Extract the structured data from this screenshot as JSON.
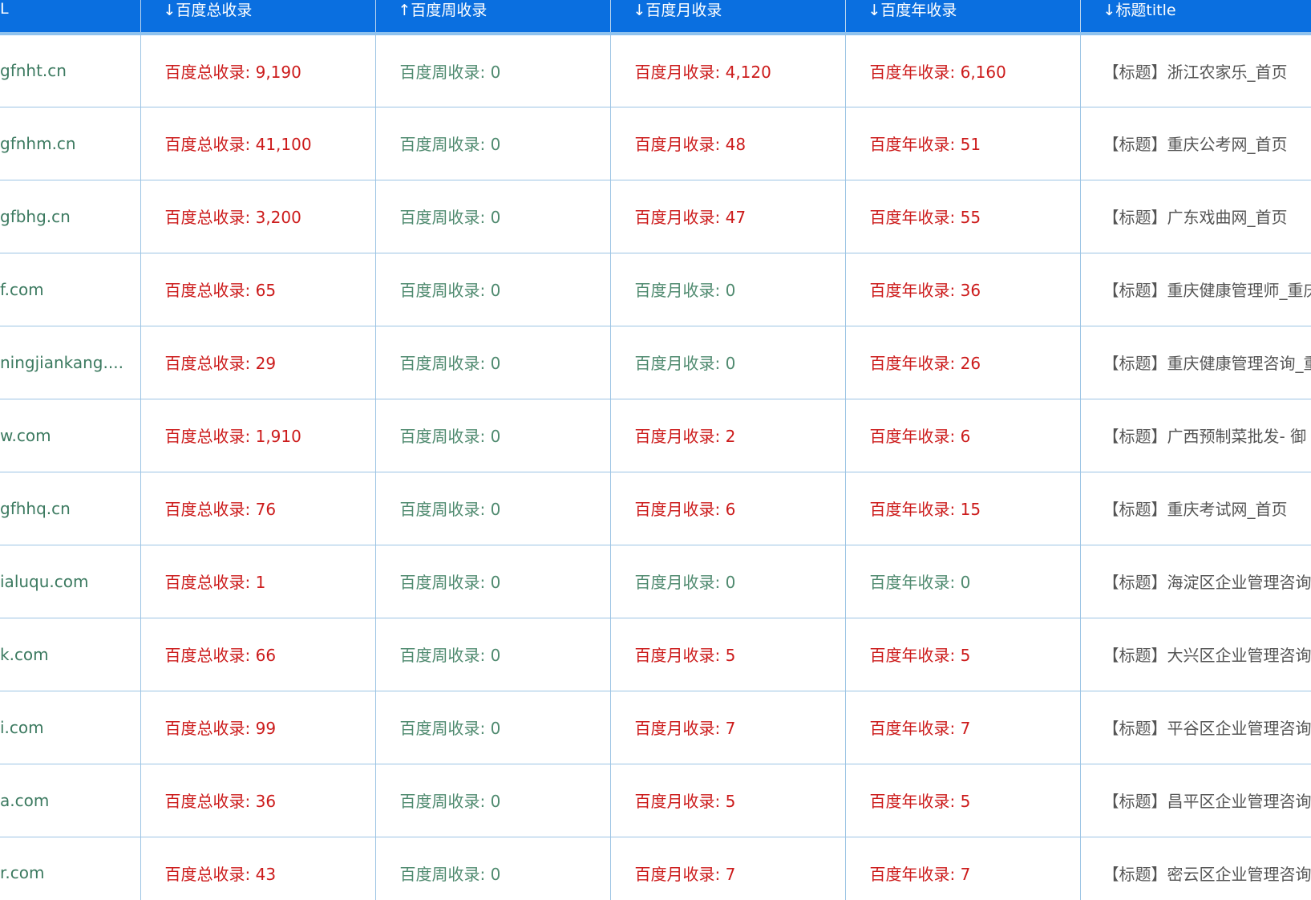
{
  "colors": {
    "header_bg": "#0a6fe0",
    "value_nonzero": "#cc1b1b",
    "value_zero": "#4f8a6f",
    "url_text": "#3c7a60"
  },
  "header": [
    "L",
    "↓百度总收录",
    "↑百度周收录",
    "↓百度月收录",
    "↓百度年收录",
    "↓标题title"
  ],
  "rows": [
    {
      "url": "gfnht.cn",
      "total": "百度总收录: 9,190",
      "week": "百度周收录: 0",
      "month": "百度月收录: 4,120",
      "year": "百度年收录: 6,160",
      "title": "【标题】浙江农家乐_首页"
    },
    {
      "url": "gfnhm.cn",
      "total": "百度总收录: 41,100",
      "week": "百度周收录: 0",
      "month": "百度月收录: 48",
      "year": "百度年收录: 51",
      "title": "【标题】重庆公考网_首页"
    },
    {
      "url": "gfbhg.cn",
      "total": "百度总收录: 3,200",
      "week": "百度周收录: 0",
      "month": "百度月收录: 47",
      "year": "百度年收录: 55",
      "title": "【标题】广东戏曲网_首页"
    },
    {
      "url": "f.com",
      "total": "百度总收录: 65",
      "week": "百度周收录: 0",
      "month": "百度月收录: 0",
      "year": "百度年收录: 36",
      "title": "【标题】重庆健康管理师_重庆"
    },
    {
      "url": "ningjiankang....",
      "total": "百度总收录: 29",
      "week": "百度周收录: 0",
      "month": "百度月收录: 0",
      "year": "百度年收录: 26",
      "title": "【标题】重庆健康管理咨询_重"
    },
    {
      "url": "w.com",
      "total": "百度总收录: 1,910",
      "week": "百度周收录: 0",
      "month": "百度月收录: 2",
      "year": "百度年收录: 6",
      "title": "【标题】广西预制菜批发- 御"
    },
    {
      "url": "gfhhq.cn",
      "total": "百度总收录: 76",
      "week": "百度周收录: 0",
      "month": "百度月收录: 6",
      "year": "百度年收录: 15",
      "title": "【标题】重庆考试网_首页"
    },
    {
      "url": "ialuqu.com",
      "total": "百度总收录: 1",
      "week": "百度周收录: 0",
      "month": "百度月收录: 0",
      "year": "百度年收录: 0",
      "title": "【标题】海淀区企业管理咨询"
    },
    {
      "url": "k.com",
      "total": "百度总收录: 66",
      "week": "百度周收录: 0",
      "month": "百度月收录: 5",
      "year": "百度年收录: 5",
      "title": "【标题】大兴区企业管理咨询"
    },
    {
      "url": "i.com",
      "total": "百度总收录: 99",
      "week": "百度周收录: 0",
      "month": "百度月收录: 7",
      "year": "百度年收录: 7",
      "title": "【标题】平谷区企业管理咨询"
    },
    {
      "url": "a.com",
      "total": "百度总收录: 36",
      "week": "百度周收录: 0",
      "month": "百度月收录: 5",
      "year": "百度年收录: 5",
      "title": "【标题】昌平区企业管理咨询"
    },
    {
      "url": "r.com",
      "total": "百度总收录: 43",
      "week": "百度周收录: 0",
      "month": "百度月收录: 7",
      "year": "百度年收录: 7",
      "title": "【标题】密云区企业管理咨询"
    }
  ]
}
